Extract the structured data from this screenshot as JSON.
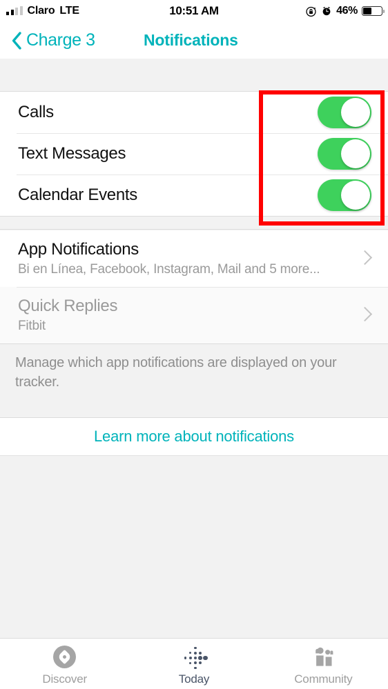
{
  "status_bar": {
    "carrier": "Claro",
    "network": "LTE",
    "time": "10:51 AM",
    "battery_percent": "46%",
    "signal_bars_filled": 2,
    "signal_bars_total": 4,
    "icons": [
      "rotation-lock-icon",
      "alarm-clock-icon",
      "battery-icon"
    ]
  },
  "nav_bar": {
    "back_label": "Charge 3",
    "title": "Notifications",
    "accent_color": "#00B3BA"
  },
  "toggles": [
    {
      "label": "Calls",
      "on": true
    },
    {
      "label": "Text Messages",
      "on": true
    },
    {
      "label": "Calendar Events",
      "on": true
    }
  ],
  "toggle_on_color": "#3ED15C",
  "links": [
    {
      "title": "App Notifications",
      "subtitle": "Bi en Línea, Facebook, Instagram, Mail and 5 more...",
      "disabled": false
    },
    {
      "title": "Quick Replies",
      "subtitle": "Fitbit",
      "disabled": true
    }
  ],
  "footer_note": "Manage which app notifications are displayed on your tracker.",
  "learn_more_link": "Learn more about notifications",
  "tab_bar": {
    "tabs": [
      {
        "label": "Discover",
        "icon": "compass-icon",
        "active": false
      },
      {
        "label": "Today",
        "icon": "fitbit-dots-icon",
        "active": true
      },
      {
        "label": "Community",
        "icon": "people-icon",
        "active": false
      }
    ]
  },
  "annotation": {
    "color": "#FF0000",
    "shape": "rectangle-highlight"
  }
}
